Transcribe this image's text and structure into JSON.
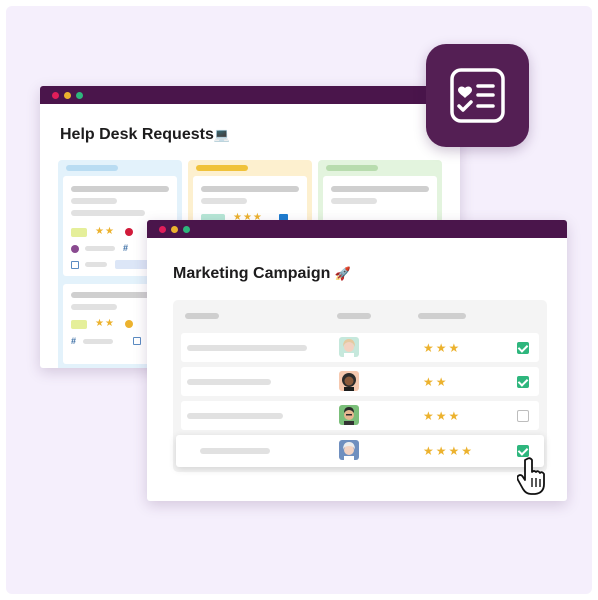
{
  "help_desk": {
    "title": "Help Desk Requests",
    "title_emoji": "💻",
    "columns": [
      {
        "name": "blue",
        "bg": "#e3f2fb",
        "header": "#b9dcf2"
      },
      {
        "name": "yellow",
        "bg": "#fdf0cf",
        "header": "#f0c23a"
      },
      {
        "name": "green",
        "bg": "#e3f4de",
        "header": "#b8dcae"
      }
    ],
    "card_stars": [
      "★★",
      "★★★",
      "★★"
    ]
  },
  "marketing": {
    "title": "Marketing Campaign",
    "title_emoji": "🚀",
    "rows": [
      {
        "stars": "★★★",
        "checked": true
      },
      {
        "stars": "★★",
        "checked": true
      },
      {
        "stars": "★★★",
        "checked": false
      },
      {
        "stars": "★★★★",
        "checked": true
      }
    ]
  },
  "colors": {
    "titlebar": "#4a154b",
    "accent_purple": "#541f54",
    "star": "#ecb22e",
    "check": "#2eb67d"
  },
  "icons": [
    "checklist-app-icon",
    "hand-pointer-cursor-icon"
  ]
}
